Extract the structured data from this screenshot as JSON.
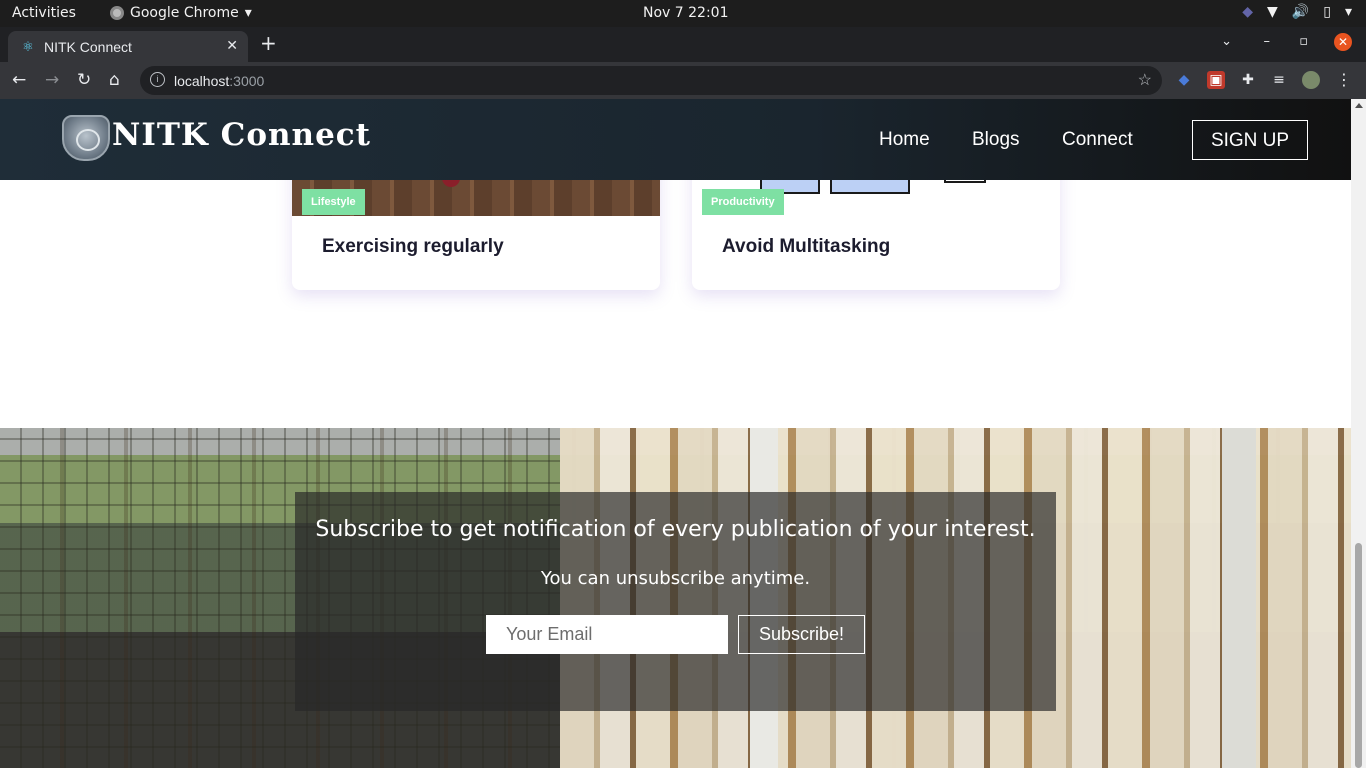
{
  "system_bar": {
    "activities": "Activities",
    "app_name": "Google Chrome",
    "clock": "Nov 7  22:01"
  },
  "browser": {
    "tab_title": "NITK Connect",
    "url_host": "localhost",
    "url_port": ":3000"
  },
  "site_nav": {
    "brand": "NITK Connect",
    "links": [
      "Home",
      "Blogs",
      "Connect"
    ],
    "signup_label": "SIGN UP"
  },
  "cards": [
    {
      "tag": "Lifestyle",
      "title": "Exercising regularly"
    },
    {
      "tag": "Productivity",
      "title": "Avoid Multitasking"
    }
  ],
  "subscribe": {
    "heading": "Subscribe to get notification of every publication of your interest.",
    "note": "You can unsubscribe anytime.",
    "email_placeholder": "Your Email",
    "button_label": "Subscribe!"
  },
  "colors": {
    "tag_bg": "#7ee0a3",
    "nav_bg": "#1f2d38",
    "close_btn": "#e95420"
  }
}
